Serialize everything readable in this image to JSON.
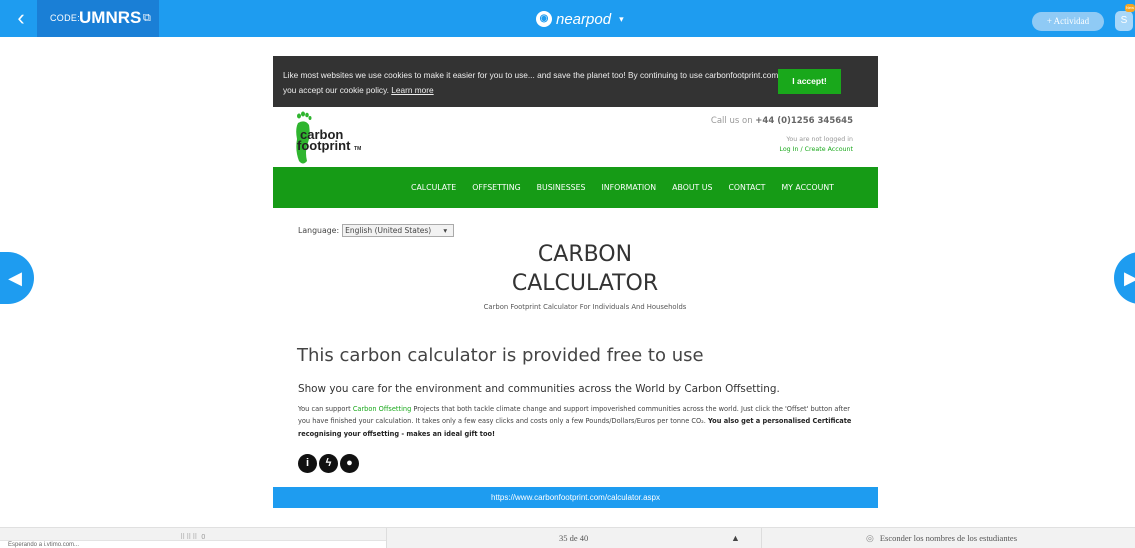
{
  "topbar": {
    "back_icon": "chevron-left-icon",
    "code_label": "CODE:",
    "code_value": "UMNRS",
    "share_icon": "external-link-icon",
    "brand_logo": "nearpod-logo",
    "brand_name": "nearpod",
    "brand_caret": "▾",
    "activity_button": "+ Actividad",
    "avatar_initial": "S",
    "avatar_badge": "New",
    "accent_color": "#1e9cf0"
  },
  "side_nav": {
    "prev_icon": "◀",
    "next_icon": "▶"
  },
  "site": {
    "cookie_text": "Like most websites we use cookies to make it easier for you to use... and save the planet too! By continuing to use carbonfootprint.com you accept our cookie policy.",
    "cookie_link": "Learn more",
    "cookie_accept": "I accept!",
    "logo_line1": "carbon",
    "logo_line2": "footprint",
    "logo_tm": "TM",
    "call_prefix": "Call us on",
    "call_number": "+44 (0)1256 345645",
    "login_status": "You are not logged in",
    "login_link": "Log In / Create Account",
    "nav_items": [
      "CALCULATE",
      "OFFSETTING",
      "BUSINESSES",
      "INFORMATION",
      "ABOUT US",
      "CONTACT",
      "MY ACCOUNT"
    ],
    "language_label": "Language:",
    "language_value": "English (United States)",
    "language_caret": "▾",
    "calc_title_line1": "CARBON",
    "calc_title_line2": "CALCULATOR",
    "calc_subtitle": "Carbon Footprint Calculator For Individuals And Households",
    "free_heading": "This carbon calculator is provided free to use",
    "show_heading": "Show you care for the environment and communities across the World by Carbon Offsetting.",
    "para_start": "You can support",
    "para_link": "Carbon Offsetting",
    "para_rest": "Projects that both tackle climate change and support impoverished communities across the world. Just click the 'Offset' button after you have finished your calculation. It takes only a few easy clicks and costs only a few Pounds/Dollars/Euros per tonne CO₂.",
    "para_bold": "You also get a personalised Certificate recognising your offsetting - makes an ideal gift too!",
    "social_icons": [
      "i",
      "ϟ",
      "●"
    ],
    "green_color": "#169b16"
  },
  "url_bar": "https://www.carbonfootprint.com/calculator.aspx",
  "bottom_bar": {
    "students_indicator": "⠿⠿⠿ 0",
    "status_line": "Esperando a i.vtimo.com...",
    "page_counter": "35 de 40",
    "page_up": "▲",
    "eye_icon": "◎",
    "hide_names": "Esconder los nombres de los estudiantes"
  }
}
